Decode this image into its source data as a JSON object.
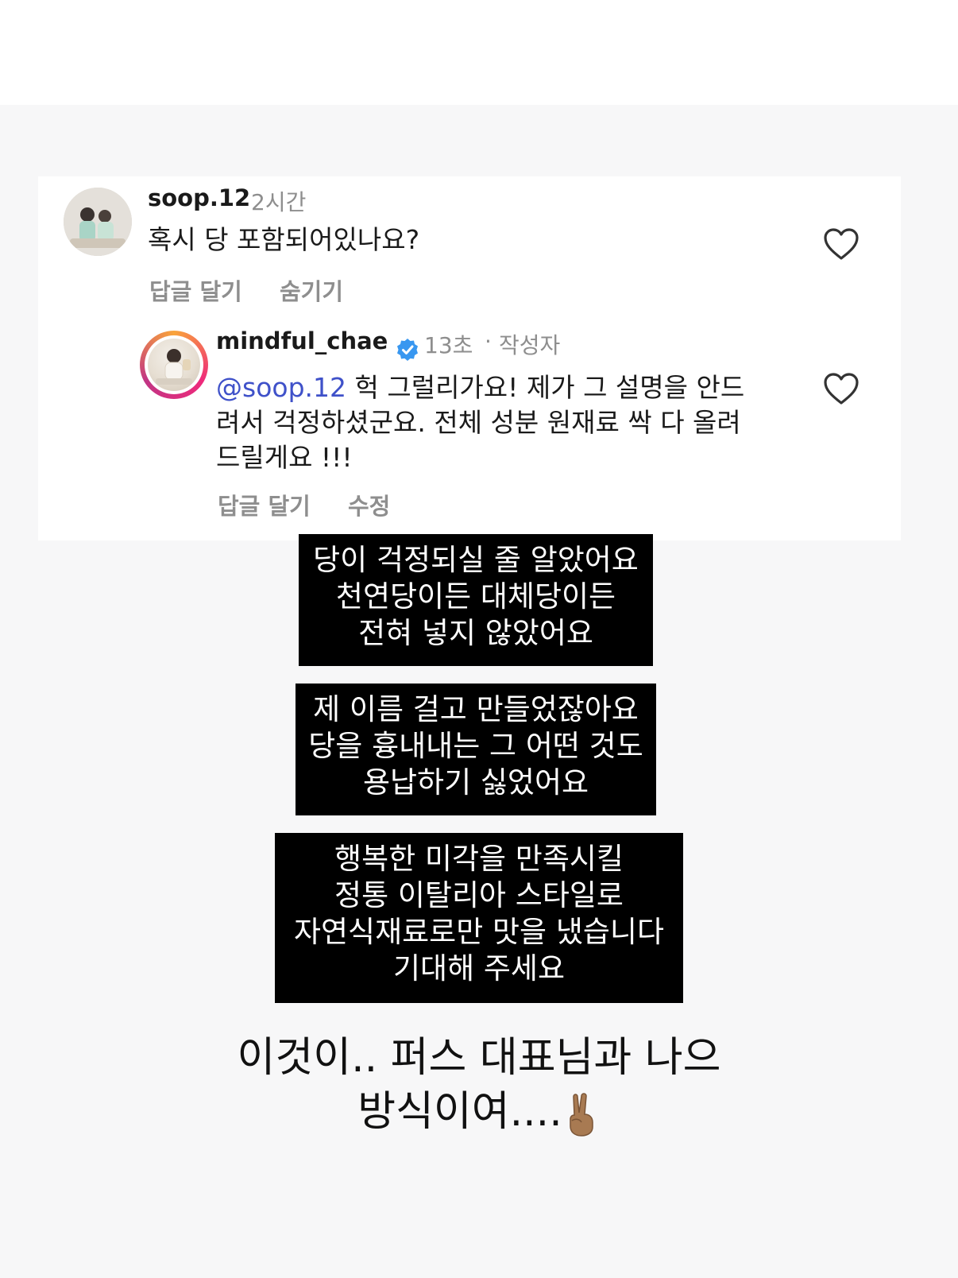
{
  "comment": {
    "username": "soop.12",
    "time": "2시간",
    "text": "혹시 당 포함되어있나요?",
    "actions": {
      "reply": "답글 달기",
      "hide": "숨기기"
    }
  },
  "reply": {
    "username": "mindful_chae",
    "time": "13초",
    "separator": "·",
    "author_tag": "작성자",
    "mention": "@soop.12",
    "text_line1": " 헉 그럴리가요! 제가 그 설명을 안드",
    "text_line2": "려서 걱정하셨군요. 전체 성분 원재료 싹 다 올려",
    "text_line3": "드릴게요 !!!",
    "actions": {
      "reply": "답글 달기",
      "edit": "수정"
    }
  },
  "captions": [
    {
      "lines": [
        "당이 걱정되실 줄 알았어요",
        "천연당이든 대체당이든",
        "전혀 넣지 않았어요"
      ]
    },
    {
      "lines": [
        "제 이름 걸고 만들었잖아요",
        "당을 흉내내는 그 어떤 것도",
        "용납하기 싫었어요"
      ]
    },
    {
      "lines": [
        "행복한 미각을 만족시킬",
        "정통 이탈리아 스타일로",
        "자연식재료로만 맛을 냈습니다",
        "기대해 주세요"
      ]
    }
  ],
  "bottom_text": {
    "line1": "이것이.. 퍼스 대표님과 나으",
    "line2": "방식이여....",
    "emoji": "victory-hand-emoji"
  },
  "colors": {
    "mention": "#3f51c9",
    "verified": "#3897f0",
    "meta": "#8e8e8e"
  }
}
